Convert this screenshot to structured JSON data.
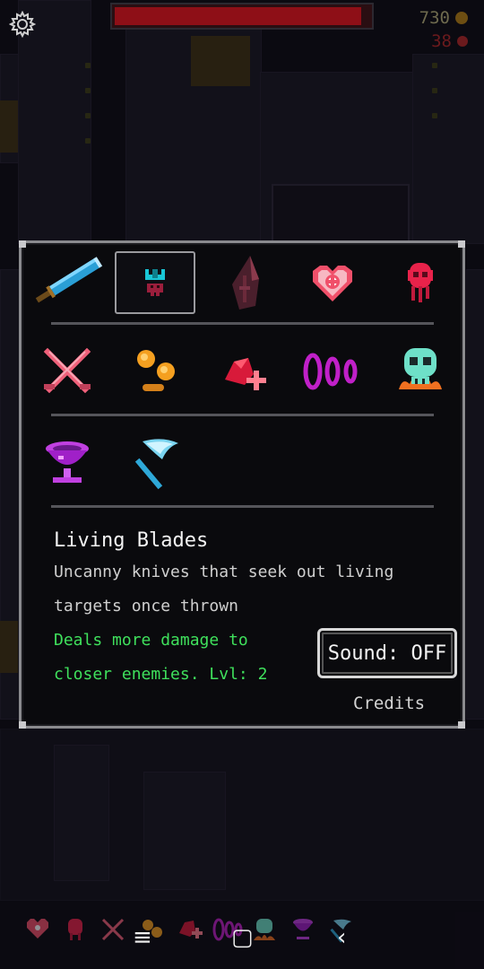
{
  "hud": {
    "gold": "730",
    "kills": "38",
    "health_fraction": 0.97
  },
  "upgrades": {
    "row1": [
      "blade-sword-icon",
      "crab-mask-icon",
      "spear-tip-icon",
      "heart-shield-icon",
      "ghost-skull-icon"
    ],
    "row2": [
      "crossed-swords-icon",
      "coins-icon",
      "blood-heal-icon",
      "rings-icon",
      "flaming-skull-icon"
    ],
    "row3": [
      "purple-chalice-icon",
      "ice-axe-icon"
    ],
    "selected": "crab-mask-icon"
  },
  "detail": {
    "title": "Living Blades",
    "description": "Uncanny knives that seek out living targets once thrown",
    "effect": "Deals more damage to closer enemies. Lvl: 2"
  },
  "buttons": {
    "sound": "Sound: OFF",
    "credits": "Credits"
  },
  "nav": {
    "menu": "≡",
    "home": "▢",
    "back": "‹"
  }
}
